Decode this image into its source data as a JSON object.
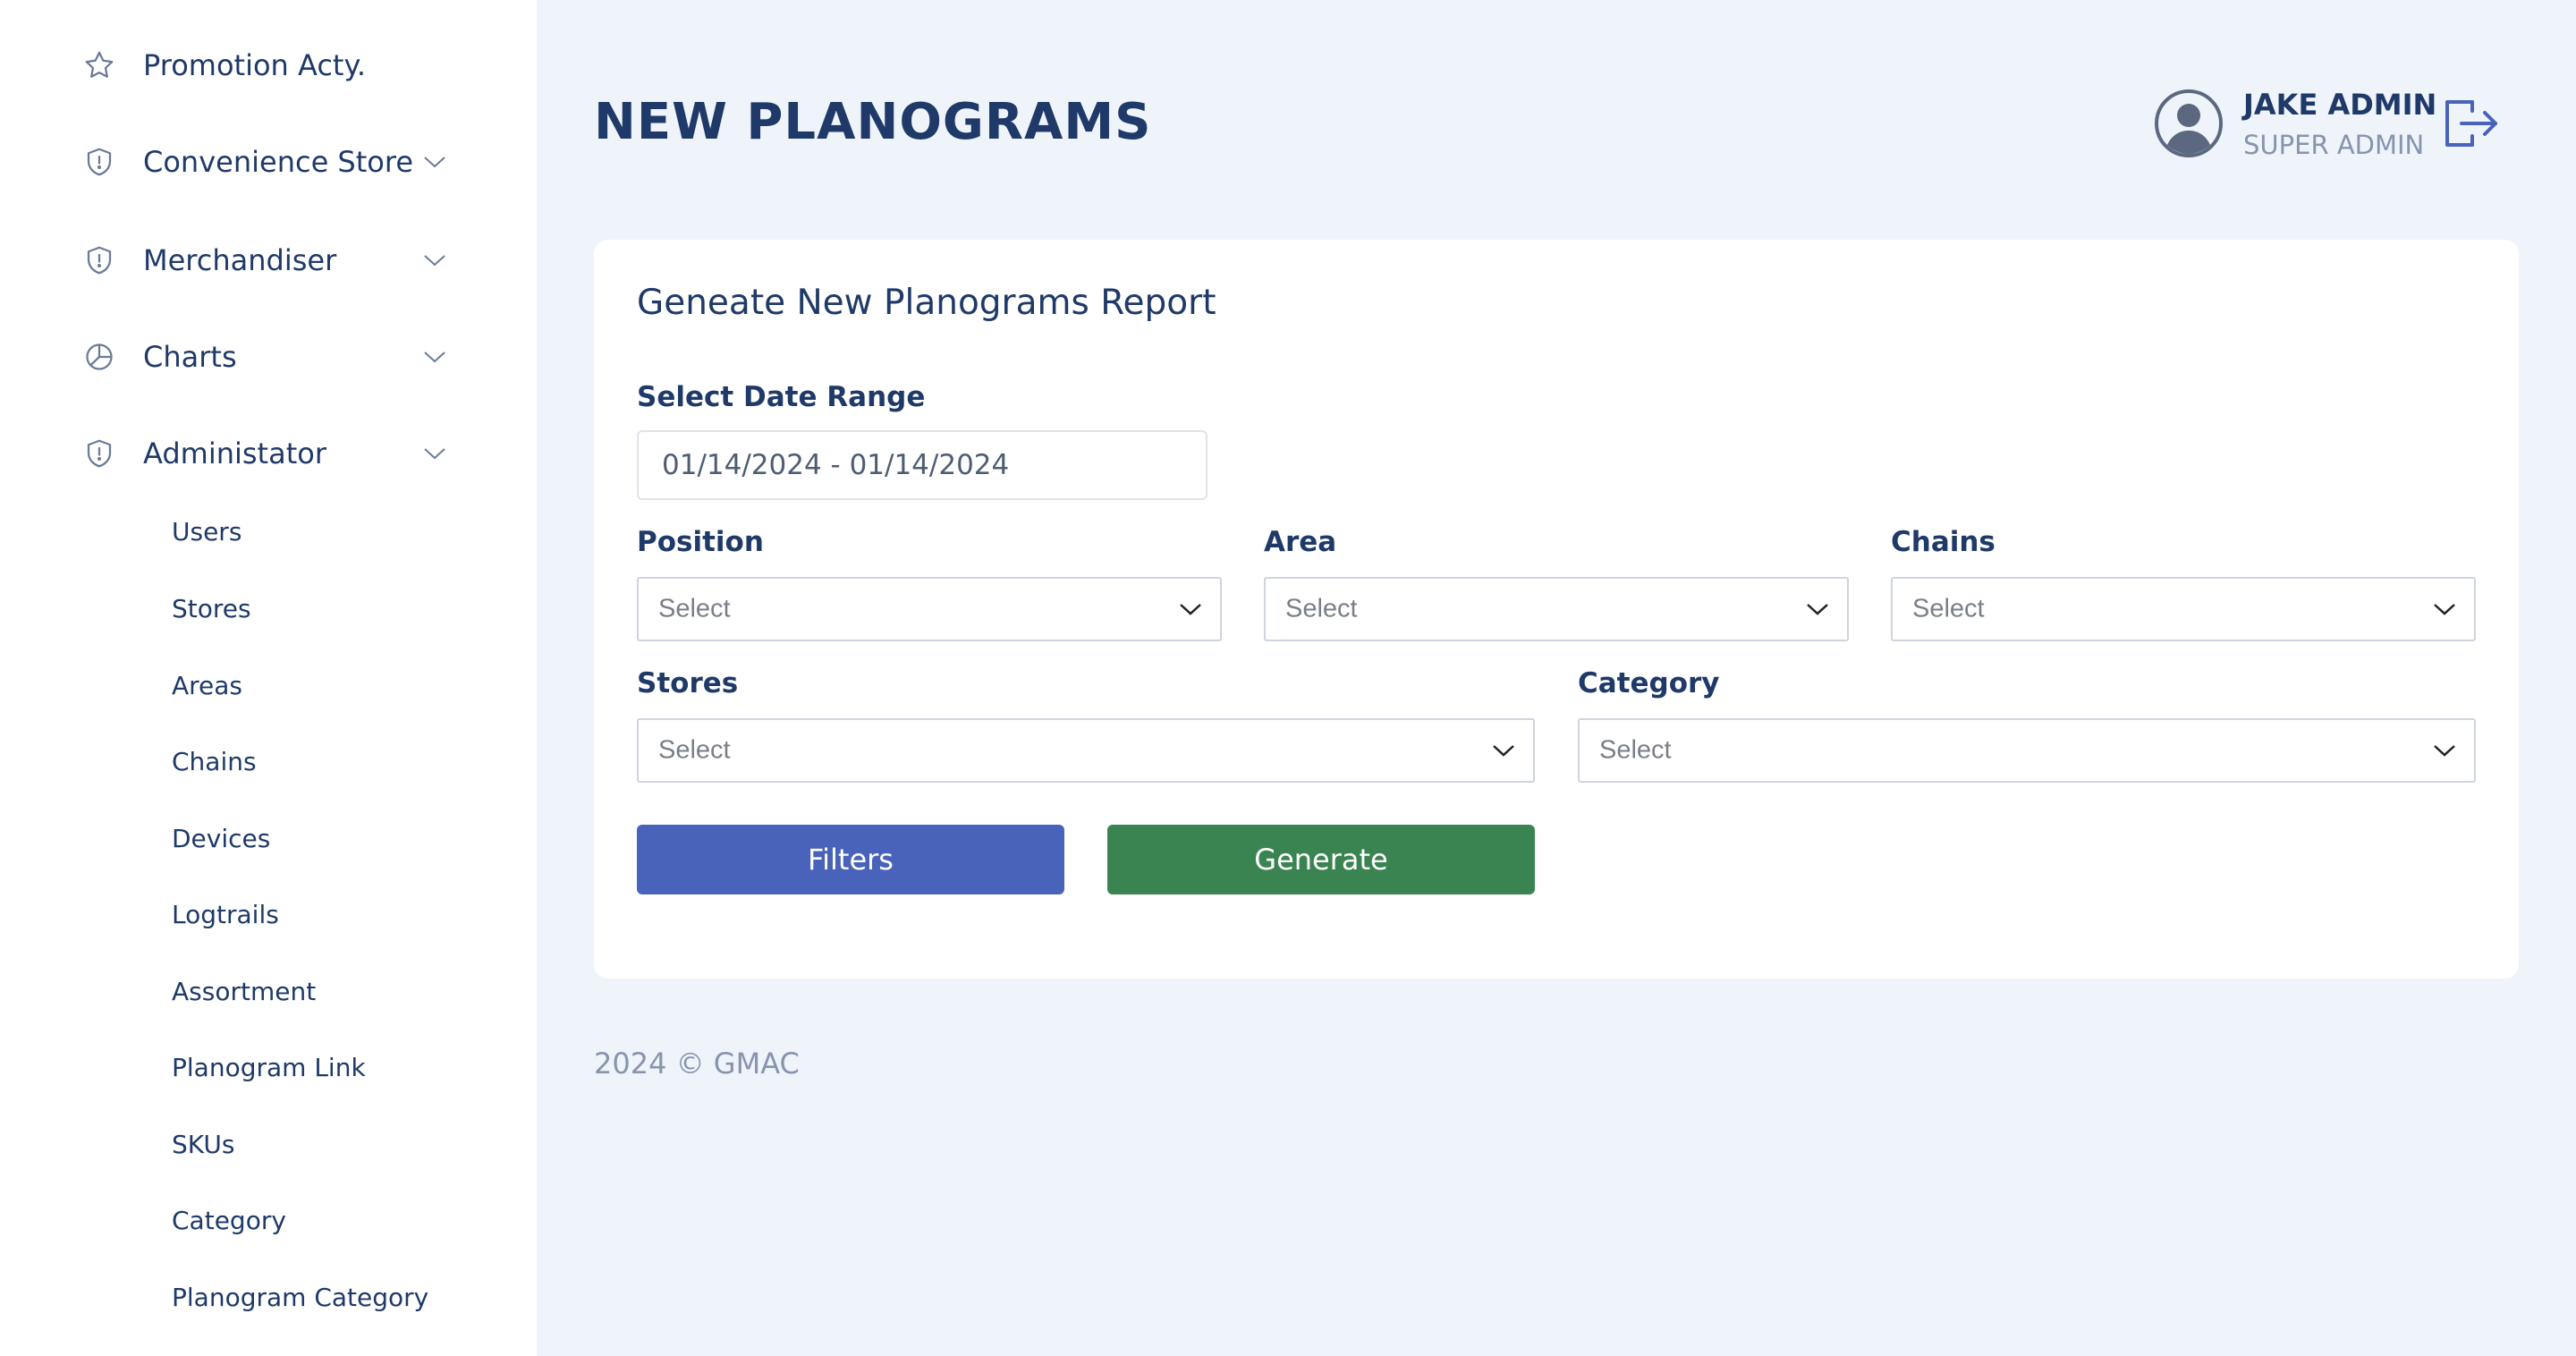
{
  "sidebar": {
    "items": [
      {
        "label": "Promotion Acty.",
        "icon": "star-icon",
        "expandable": false
      },
      {
        "label": "Convenience Store",
        "icon": "shield-icon",
        "expandable": true
      },
      {
        "label": "Merchandiser",
        "icon": "shield-icon",
        "expandable": true
      },
      {
        "label": "Charts",
        "icon": "pie-chart-icon",
        "expandable": true
      },
      {
        "label": "Administator",
        "icon": "shield-icon",
        "expandable": true
      }
    ],
    "subitems": [
      "Users",
      "Stores",
      "Areas",
      "Chains",
      "Devices",
      "Logtrails",
      "Assortment",
      "Planogram Link",
      "SKUs",
      "Category",
      "Planogram Category"
    ]
  },
  "header": {
    "title": "NEW PLANOGRAMS",
    "user_name": "JAKE ADMIN",
    "user_role": "SUPER ADMIN"
  },
  "card": {
    "title": "Geneate New Planograms Report",
    "date_range_label": "Select Date Range",
    "date_range_value": "01/14/2024 - 01/14/2024",
    "position_label": "Position",
    "position_value": "Select",
    "area_label": "Area",
    "area_value": "Select",
    "chains_label": "Chains",
    "chains_value": "Select",
    "stores_label": "Stores",
    "stores_value": "Select",
    "category_label": "Category",
    "category_value": "Select",
    "filters_label": "Filters",
    "generate_label": "Generate"
  },
  "footer": {
    "text": "2024 © GMAC"
  },
  "colors": {
    "primary": "#4963bb",
    "success": "#3a8452",
    "text_dark": "#1f3a68",
    "muted": "#8794ad",
    "background": "#eff4fb"
  }
}
